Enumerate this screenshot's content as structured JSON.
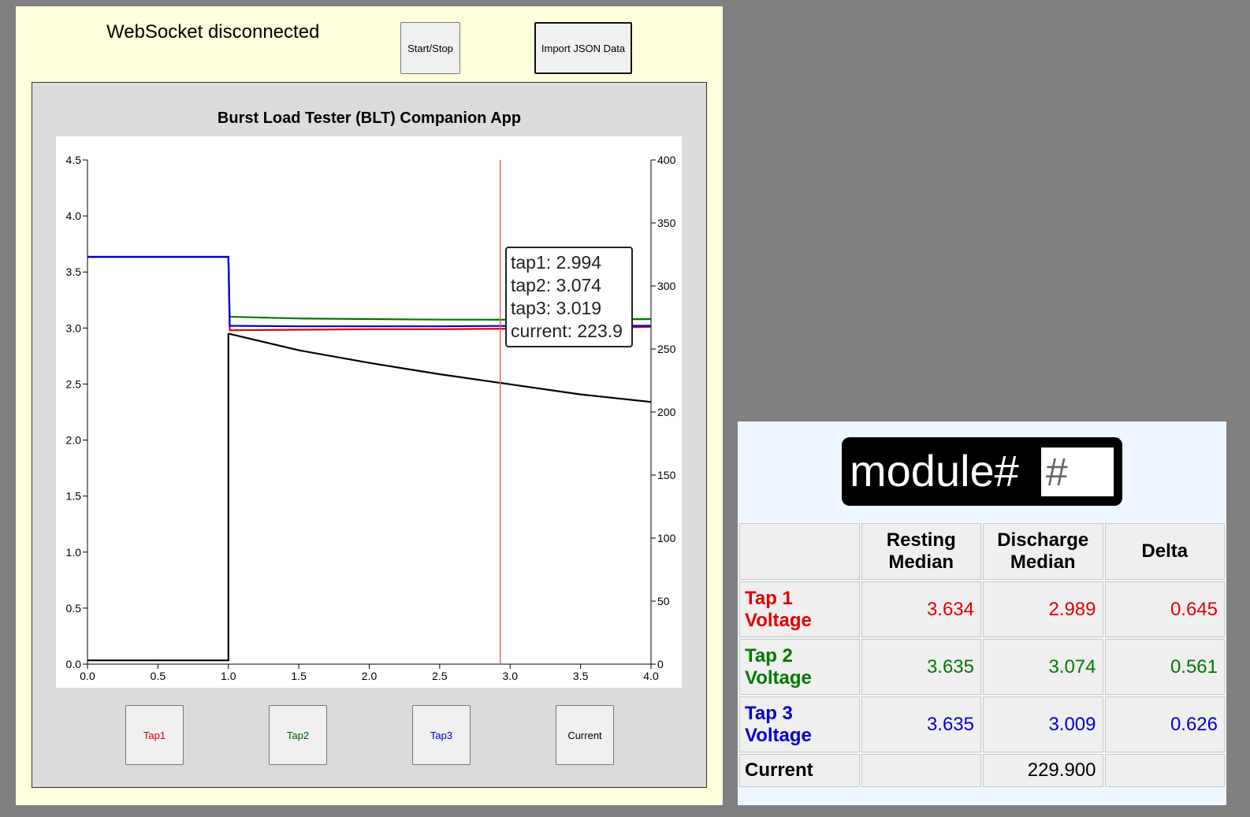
{
  "status": {
    "websocket": "WebSocket disconnected"
  },
  "toolbar": {
    "start_stop": "Start/Stop",
    "import_json": "Import JSON Data"
  },
  "series_buttons": {
    "tap1": "Tap1",
    "tap2": "Tap2",
    "tap3": "Tap3",
    "current": "Current"
  },
  "tooltip": {
    "tap1": "tap1: 2.994",
    "tap2": "tap2: 3.074",
    "tap3": "tap3: 3.019",
    "current": "current: 223.9"
  },
  "colors": {
    "tap1": "#e00000",
    "tap2": "#007800",
    "tap3": "#0000d0",
    "current": "#000000",
    "cursor": "#f06060"
  },
  "chart_data": {
    "type": "line",
    "title": "Burst Load Tester (BLT) Companion App",
    "xlim": [
      0,
      4.0
    ],
    "ylim": [
      0,
      4.5
    ],
    "y2lim": [
      0,
      400
    ],
    "x_ticks": [
      "0.0",
      "0.5",
      "1.0",
      "1.5",
      "2.0",
      "2.5",
      "3.0",
      "3.5",
      "4.0"
    ],
    "y_ticks": [
      "0.0",
      "0.5",
      "1.0",
      "1.5",
      "2.0",
      "2.5",
      "3.0",
      "3.5",
      "4.0",
      "4.5"
    ],
    "y2_ticks": [
      "0",
      "50",
      "100",
      "150",
      "200",
      "250",
      "300",
      "350",
      "400"
    ],
    "cursor_x": 2.93,
    "series": [
      {
        "name": "tap1",
        "axis": "left",
        "x": [
          0,
          1.0,
          1.01,
          1.5,
          2.0,
          2.5,
          3.0,
          3.5,
          4.0
        ],
        "y": [
          3.634,
          3.634,
          2.98,
          2.985,
          2.99,
          2.99,
          2.994,
          3.0,
          3.01
        ]
      },
      {
        "name": "tap2",
        "axis": "left",
        "x": [
          0,
          1.0,
          1.01,
          1.5,
          2.0,
          2.5,
          3.0,
          3.5,
          4.0
        ],
        "y": [
          3.635,
          3.635,
          3.1,
          3.085,
          3.08,
          3.075,
          3.074,
          3.075,
          3.08
        ]
      },
      {
        "name": "tap3",
        "axis": "left",
        "x": [
          0,
          1.0,
          1.01,
          1.5,
          2.0,
          2.5,
          3.0,
          3.5,
          4.0
        ],
        "y": [
          3.635,
          3.635,
          3.02,
          3.015,
          3.015,
          3.015,
          3.019,
          3.02,
          3.02
        ]
      },
      {
        "name": "current",
        "axis": "right",
        "x": [
          0,
          1.0,
          1.0,
          1.01,
          1.5,
          2.0,
          2.5,
          3.0,
          3.5,
          4.0
        ],
        "y": [
          3,
          3,
          262,
          262,
          249,
          239,
          230,
          222,
          214,
          208
        ]
      }
    ]
  },
  "module": {
    "label": "module#",
    "placeholder": "#"
  },
  "stats_table": {
    "headers": [
      "",
      "Resting Median",
      "Discharge Median",
      "Delta"
    ],
    "rows": [
      {
        "label": "Tap 1 Voltage",
        "resting": "3.634",
        "discharge": "2.989",
        "delta": "0.645"
      },
      {
        "label": "Tap 2 Voltage",
        "resting": "3.635",
        "discharge": "3.074",
        "delta": "0.561"
      },
      {
        "label": "Tap 3 Voltage",
        "resting": "3.635",
        "discharge": "3.009",
        "delta": "0.626"
      },
      {
        "label": "Current",
        "resting": "",
        "discharge": "229.900",
        "delta": ""
      }
    ]
  }
}
